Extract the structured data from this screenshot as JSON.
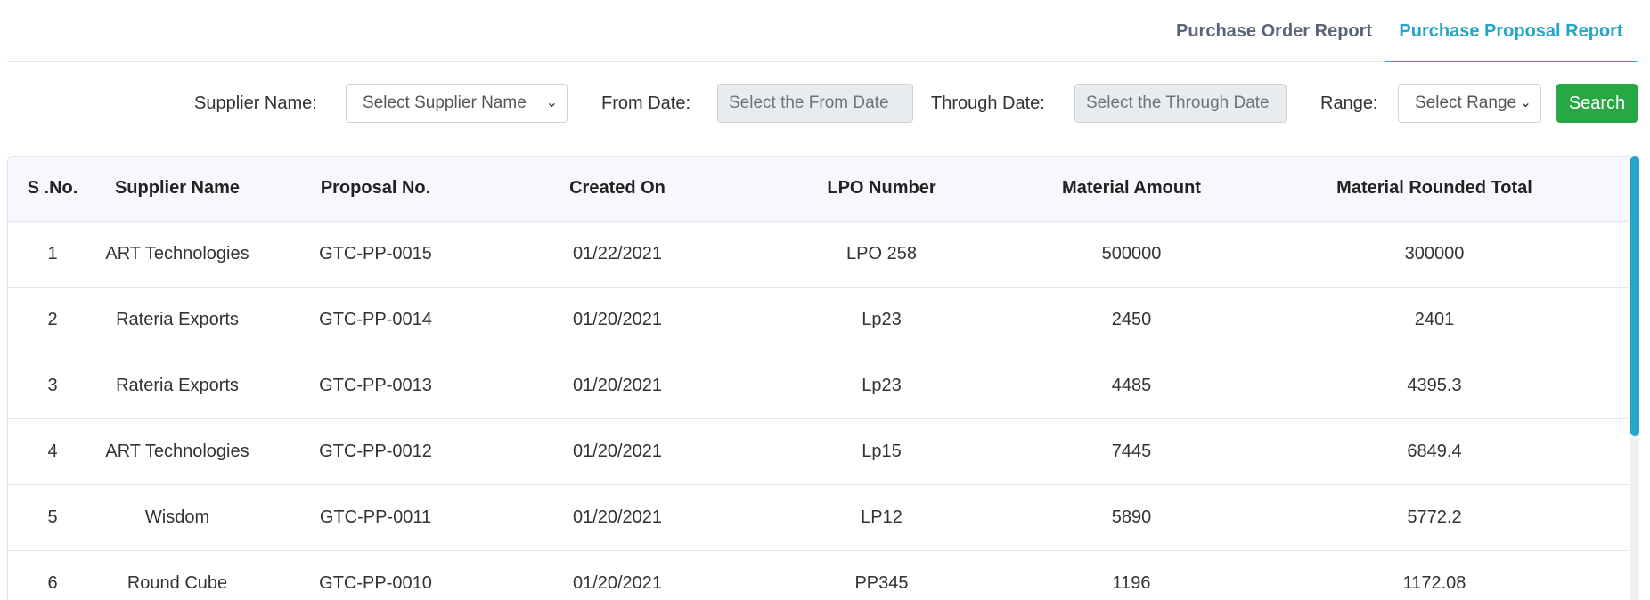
{
  "tabs": {
    "order_report": "Purchase Order Report",
    "proposal_report": "Purchase Proposal Report"
  },
  "filters": {
    "supplier_label": "Supplier Name:",
    "supplier_placeholder": "Select Supplier Name",
    "from_label": "From Date:",
    "from_placeholder": "Select the From Date",
    "through_label": "Through Date:",
    "through_placeholder": "Select the Through Date",
    "range_label": "Range:",
    "range_placeholder": "Select Range",
    "search_label": "Search"
  },
  "table": {
    "headers": [
      "S .No.",
      "Supplier Name",
      "Proposal No.",
      "Created On",
      "LPO Number",
      "Material Amount",
      "Material Rounded Total"
    ],
    "rows": [
      [
        "1",
        "ART Technologies",
        "GTC-PP-0015",
        "01/22/2021",
        "LPO 258",
        "500000",
        "300000"
      ],
      [
        "2",
        "Rateria Exports",
        "GTC-PP-0014",
        "01/20/2021",
        "Lp23",
        "2450",
        "2401"
      ],
      [
        "3",
        "Rateria Exports",
        "GTC-PP-0013",
        "01/20/2021",
        "Lp23",
        "4485",
        "4395.3"
      ],
      [
        "4",
        "ART Technologies",
        "GTC-PP-0012",
        "01/20/2021",
        "Lp15",
        "7445",
        "6849.4"
      ],
      [
        "5",
        "Wisdom",
        "GTC-PP-0011",
        "01/20/2021",
        "LP12",
        "5890",
        "5772.2"
      ],
      [
        "6",
        "Round Cube",
        "GTC-PP-0010",
        "01/20/2021",
        "PP345",
        "1196",
        "1172.08"
      ]
    ]
  },
  "colors": {
    "accent": "#23a6c8",
    "search_button": "#28a745",
    "header_bg": "#f7f7fd"
  }
}
